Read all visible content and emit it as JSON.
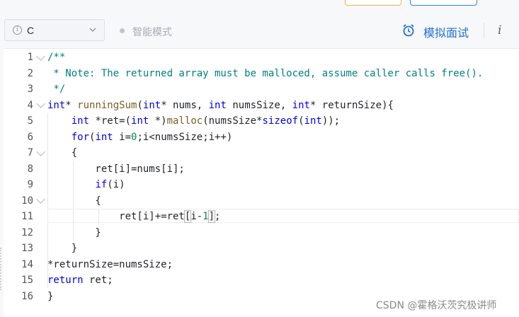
{
  "toolbar": {
    "language": "C",
    "mode_label": "智能模式",
    "simulate_label": "模拟面试",
    "info_label": "i"
  },
  "editor": {
    "line_numbers": [
      "1",
      "2",
      "3",
      "4",
      "5",
      "6",
      "7",
      "8",
      "9",
      "10",
      "11",
      "12",
      "13",
      "14",
      "15",
      "16"
    ],
    "code": {
      "l1": "/**",
      "l2": " * Note: The returned array must be malloced, assume caller calls free().",
      "l3": " */",
      "l4_t1": "int",
      "l4_t2": "* ",
      "l4_t3": "runningSum",
      "l4_t4": "(",
      "l4_t5": "int",
      "l4_t6": "* nums, ",
      "l4_t7": "int",
      "l4_t8": " numsSize, ",
      "l4_t9": "int",
      "l4_t10": "* returnSize){",
      "l5_t1": "    ",
      "l5_t2": "int",
      "l5_t3": " *ret=(",
      "l5_t4": "int",
      "l5_t5": " *)",
      "l5_t6": "malloc",
      "l5_t7": "(numsSize*",
      "l5_t8": "sizeof",
      "l5_t9": "(",
      "l5_t10": "int",
      "l5_t11": "));",
      "l6_t1": "    ",
      "l6_t2": "for",
      "l6_t3": "(",
      "l6_t4": "int",
      "l6_t5": " i=",
      "l6_t6": "0",
      "l6_t7": ";i<numsSize;i++)",
      "l7": "    {",
      "l8": "        ret[i]=nums[i];",
      "l9_t1": "        ",
      "l9_t2": "if",
      "l9_t3": "(i)",
      "l10": "        {",
      "l11_t1": "            ret[i]+=ret",
      "l11_t2": "[",
      "l11_t3": "i-",
      "l11_t4": "1",
      "l11_t5": "]",
      "l11_t6": ";",
      "l12": "        }",
      "l13": "    }",
      "l14": "*returnSize=numsSize;",
      "l15_t1": "return",
      "l15_t2": " ret;",
      "l16": "}"
    }
  },
  "watermark": "CSDN @霍格沃茨究极讲师",
  "colors": {
    "keyword": "#0000ee",
    "comment": "#008080",
    "function": "#795e26",
    "number": "#098658",
    "accent": "#1f6fd6"
  }
}
